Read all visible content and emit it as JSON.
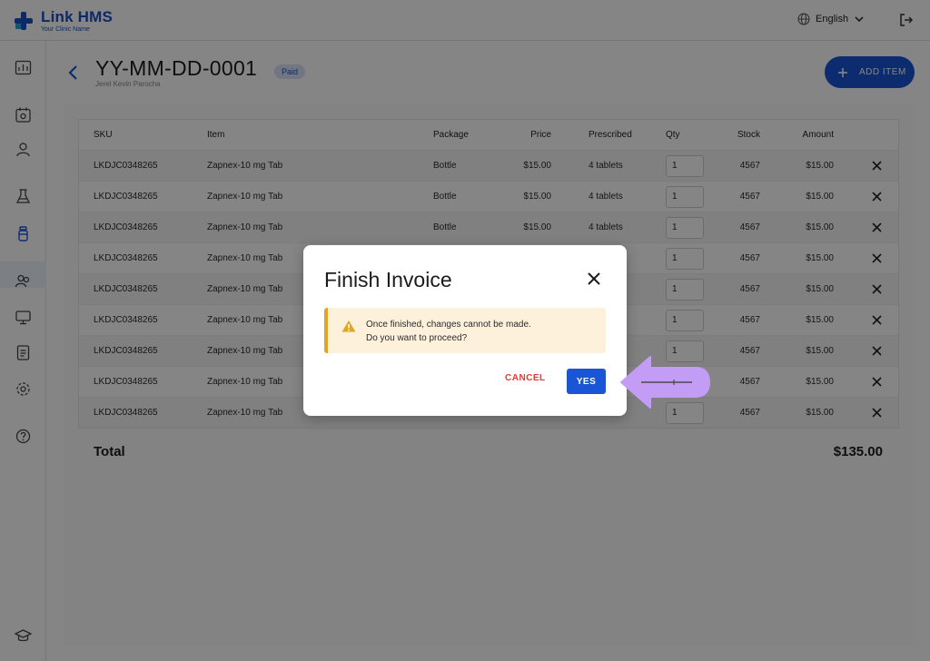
{
  "brand": {
    "name": "Link HMS",
    "tagline": "Your Clinic Name"
  },
  "header": {
    "language": "English"
  },
  "invoice": {
    "title": "YY-MM-DD-0001",
    "patient": "Jerel Kevin Parocha",
    "status": "Paid",
    "add_item_label": "ADD ITEM"
  },
  "table": {
    "headers": {
      "sku": "SKU",
      "item": "Item",
      "package": "Package",
      "price": "Price",
      "prescribed": "Prescribed",
      "qty": "Qty",
      "stock": "Stock",
      "amount": "Amount"
    },
    "rows": [
      {
        "sku": "LKDJC0348265",
        "item": "Zapnex-10 mg Tab",
        "package": "Bottle",
        "price": "$15.00",
        "prescribed": "4 tablets",
        "qty": "1",
        "stock": "4567",
        "amount": "$15.00"
      },
      {
        "sku": "LKDJC0348265",
        "item": "Zapnex-10 mg Tab",
        "package": "Bottle",
        "price": "$15.00",
        "prescribed": "4 tablets",
        "qty": "1",
        "stock": "4567",
        "amount": "$15.00"
      },
      {
        "sku": "LKDJC0348265",
        "item": "Zapnex-10 mg Tab",
        "package": "Bottle",
        "price": "$15.00",
        "prescribed": "4 tablets",
        "qty": "1",
        "stock": "4567",
        "amount": "$15.00"
      },
      {
        "sku": "LKDJC0348265",
        "item": "Zapnex-10 mg Tab",
        "package": "",
        "price": "",
        "prescribed": "",
        "qty": "1",
        "stock": "4567",
        "amount": "$15.00"
      },
      {
        "sku": "LKDJC0348265",
        "item": "Zapnex-10 mg Tab",
        "package": "",
        "price": "",
        "prescribed": "",
        "qty": "1",
        "stock": "4567",
        "amount": "$15.00"
      },
      {
        "sku": "LKDJC0348265",
        "item": "Zapnex-10 mg Tab",
        "package": "",
        "price": "",
        "prescribed": "",
        "qty": "1",
        "stock": "4567",
        "amount": "$15.00"
      },
      {
        "sku": "LKDJC0348265",
        "item": "Zapnex-10 mg Tab",
        "package": "",
        "price": "",
        "prescribed": "",
        "qty": "1",
        "stock": "4567",
        "amount": "$15.00"
      },
      {
        "sku": "LKDJC0348265",
        "item": "Zapnex-10 mg Tab",
        "package": "",
        "price": "",
        "prescribed": "",
        "qty": "1",
        "stock": "4567",
        "amount": "$15.00"
      },
      {
        "sku": "LKDJC0348265",
        "item": "Zapnex-10 mg Tab",
        "package": "",
        "price": "",
        "prescribed": "",
        "qty": "1",
        "stock": "4567",
        "amount": "$15.00"
      }
    ]
  },
  "total": {
    "label": "Total",
    "value": "$135.00"
  },
  "modal": {
    "title": "Finish Invoice",
    "message_line1": "Once finished, changes cannot be made.",
    "message_line2": "Do you want to proceed?",
    "cancel_label": "CANCEL",
    "confirm_label": "YES"
  },
  "colors": {
    "primary": "#1a55d6",
    "danger": "#e53935",
    "warning": "#e0a623",
    "pointer": "#c39cf5"
  },
  "icons": {
    "sidebar": [
      "dashboard-icon",
      "calendar-icon",
      "patient-icon",
      "lab-flask-icon",
      "pharmacy-bottle-icon",
      "users-group-icon",
      "monitor-icon",
      "report-icon",
      "settings-gear-icon",
      "help-icon",
      "graduation-cap-icon"
    ]
  }
}
